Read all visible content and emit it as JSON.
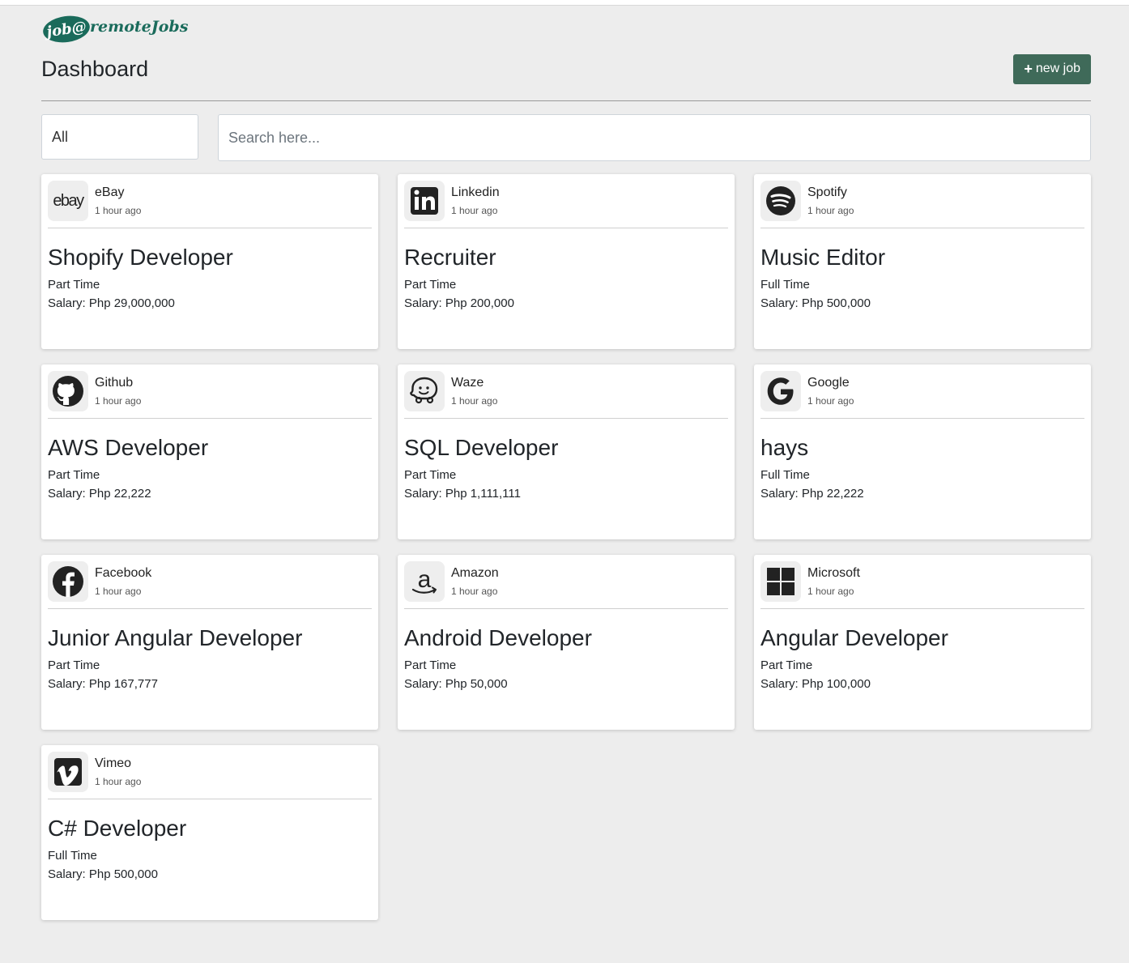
{
  "brand": {
    "oval_text": "job@",
    "text": "remoteJobs"
  },
  "header": {
    "title": "Dashboard",
    "new_job_label": "new job",
    "new_job_icon": "plus-icon"
  },
  "filter": {
    "selected": "All",
    "search_placeholder": "Search here..."
  },
  "colors": {
    "brand": "#1a6b5b",
    "button": "#3f6a59",
    "background": "#ededed"
  },
  "jobs": [
    {
      "company": "eBay",
      "logo": "ebay-logo-icon",
      "posted": "1 hour ago",
      "title": "Shopify Developer",
      "type": "Part Time",
      "salary": "Salary: Php 29,000,000"
    },
    {
      "company": "Linkedin",
      "logo": "linkedin-logo-icon",
      "posted": "1 hour ago",
      "title": "Recruiter",
      "type": "Part Time",
      "salary": "Salary: Php 200,000"
    },
    {
      "company": "Spotify",
      "logo": "spotify-logo-icon",
      "posted": "1 hour ago",
      "title": "Music Editor",
      "type": "Full Time",
      "salary": "Salary: Php 500,000"
    },
    {
      "company": "Github",
      "logo": "github-logo-icon",
      "posted": "1 hour ago",
      "title": "AWS Developer",
      "type": "Part Time",
      "salary": "Salary: Php 22,222"
    },
    {
      "company": "Waze",
      "logo": "waze-logo-icon",
      "posted": "1 hour ago",
      "title": "SQL Developer",
      "type": "Part Time",
      "salary": "Salary: Php 1,111,111"
    },
    {
      "company": "Google",
      "logo": "google-logo-icon",
      "posted": "1 hour ago",
      "title": "hays",
      "type": "Full Time",
      "salary": "Salary: Php 22,222"
    },
    {
      "company": "Facebook",
      "logo": "facebook-logo-icon",
      "posted": "1 hour ago",
      "title": "Junior Angular Developer",
      "type": "Part Time",
      "salary": "Salary: Php 167,777"
    },
    {
      "company": "Amazon",
      "logo": "amazon-logo-icon",
      "posted": "1 hour ago",
      "title": "Android Developer",
      "type": "Part Time",
      "salary": "Salary: Php 50,000"
    },
    {
      "company": "Microsoft",
      "logo": "microsoft-logo-icon",
      "posted": "1 hour ago",
      "title": "Angular Developer",
      "type": "Part Time",
      "salary": "Salary: Php 100,000"
    },
    {
      "company": "Vimeo",
      "logo": "vimeo-logo-icon",
      "posted": "1 hour ago",
      "title": "C# Developer",
      "type": "Full Time",
      "salary": "Salary: Php 500,000"
    }
  ]
}
